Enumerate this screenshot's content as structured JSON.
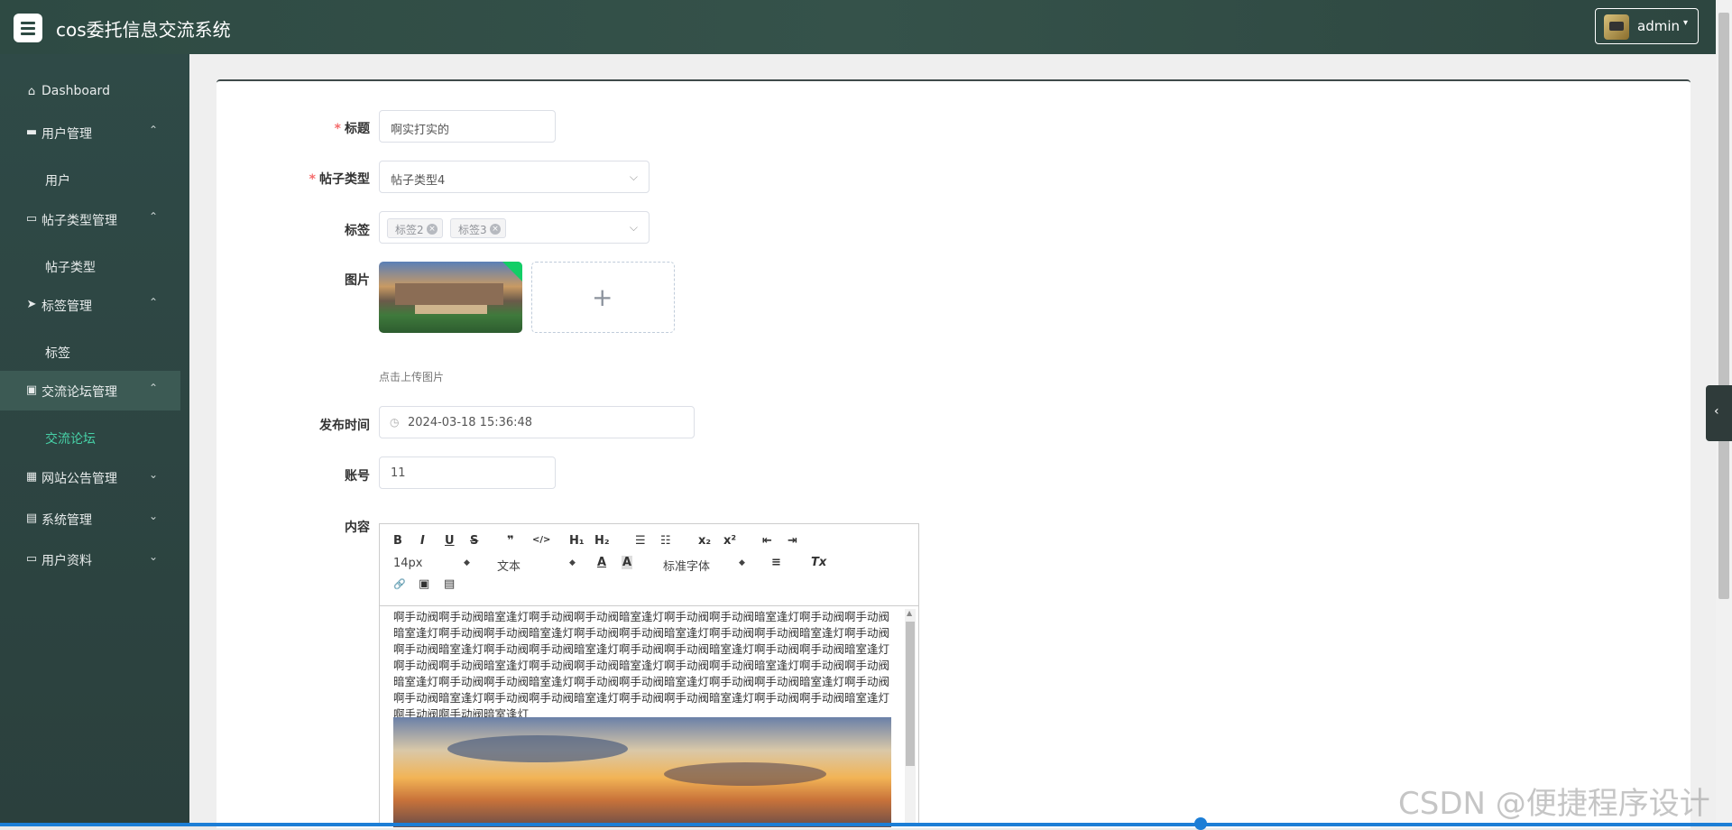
{
  "header": {
    "title": "cos委托信息交流系统",
    "user": "admin",
    "caret": "▾"
  },
  "sidebar": {
    "items": [
      {
        "label": "Dashboard",
        "icon": "home-icon"
      },
      {
        "label": "用户管理",
        "icon": "briefcase-icon",
        "chevron": "⌃"
      },
      {
        "sub": "用户"
      },
      {
        "label": "帖子类型管理",
        "icon": "monitor-icon",
        "chevron": "⌃"
      },
      {
        "sub": "帖子类型"
      },
      {
        "label": "标签管理",
        "icon": "send-icon",
        "chevron": "⌃"
      },
      {
        "sub": "标签"
      },
      {
        "label": "交流论坛管理",
        "icon": "clipboard-icon",
        "chevron": "⌃"
      },
      {
        "sub": "交流论坛"
      },
      {
        "label": "网站公告管理",
        "icon": "grid-icon",
        "chevron": "⌄"
      },
      {
        "label": "系统管理",
        "icon": "doc-icon",
        "chevron": "⌄"
      },
      {
        "label": "用户资料",
        "icon": "calendar-icon",
        "chevron": "⌄"
      }
    ]
  },
  "form": {
    "title": {
      "label": "标题",
      "required": "*",
      "value": "啊实打实的"
    },
    "post_type": {
      "label": "帖子类型",
      "required": "*",
      "value": "帖子类型4"
    },
    "tags": {
      "label": "标签",
      "values": [
        "标签2",
        "标签3"
      ]
    },
    "image": {
      "label": "图片",
      "upload_plus": "+",
      "hint": "点击上传图片"
    },
    "publish_time": {
      "label": "发布时间",
      "value": "2024-03-18 15:36:48"
    },
    "account": {
      "label": "账号",
      "value": "11"
    },
    "content": {
      "label": "内容",
      "toolbar": {
        "bold": "B",
        "italic": "I",
        "underline": "U",
        "strike": "S",
        "quote": "❞",
        "code": "</>",
        "h1": "H₁",
        "h2": "H₂",
        "ordered": "☰",
        "bullet": "☷",
        "sub": "x₂",
        "sup": "x²",
        "outdent": "⇤",
        "indent": "⇥",
        "size": "14px",
        "format": "文本",
        "font": "标准字体",
        "color": "A",
        "bg": "A",
        "align": "≡",
        "clear": "Tx",
        "link": "🔗",
        "img": "▣",
        "video": "▤"
      },
      "text": "啊手动阀啊手动阀暗室逢灯啊手动阀啊手动阀暗室逢灯啊手动阀啊手动阀暗室逢灯啊手动阀啊手动阀暗室逢灯啊手动阀啊手动阀暗室逢灯啊手动阀啊手动阀暗室逢灯啊手动阀啊手动阀暗室逢灯啊手动阀啊手动阀暗室逢灯啊手动阀啊手动阀暗室逢灯啊手动阀啊手动阀暗室逢灯啊手动阀啊手动阀暗室逢灯啊手动阀啊手动阀暗室逢灯啊手动阀啊手动阀暗室逢灯啊手动阀啊手动阀暗室逢灯啊手动阀啊手动阀暗室逢灯啊手动阀啊手动阀暗室逢灯啊手动阀啊手动阀暗室逢灯啊手动阀啊手动阀暗室逢灯啊手动阀啊手动阀暗室逢灯啊手动阀啊手动阀暗室逢灯啊手动阀啊手动阀暗室逢灯啊手动阀啊手动阀暗室逢灯啊手动阀啊手动阀暗室逢灯"
    }
  },
  "side_tab": "‹",
  "watermark": "CSDN @便捷程序设计"
}
